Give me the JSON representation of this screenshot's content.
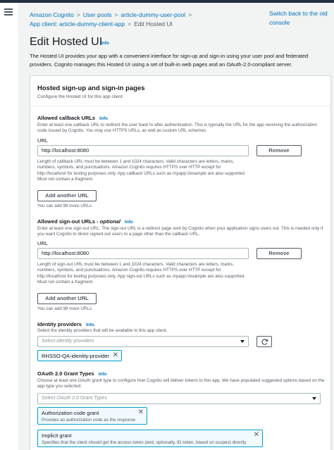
{
  "breadcrumb": {
    "items": [
      "Amazon Cognito",
      "User pools",
      "article-dummy-user-pool",
      "App client: article-dummy-client-app"
    ],
    "current": "Edit Hosted UI"
  },
  "header": {
    "switch_link": "Switch back to the old console",
    "title": "Edit Hosted UI",
    "info": "Info",
    "description": "The Hosted UI provides your app with a convenient interface for sign-up and sign-in using your user pool and federated providers. Cognito manages this Hosted UI using a set of built-in web pages and an OAuth-2.0-compliant server."
  },
  "panel": {
    "title": "Hosted sign-up and sign-in pages",
    "subtitle": "Configure the Hosted UI for this app client."
  },
  "callback": {
    "label": "Allowed callback URLs",
    "info": "Info",
    "help": "Enter at least one callback URL to redirect the user back to after authentication. This is typically the URL for the app receiving the authorization code issued by Cognito. You may use HTTPS URLs, as well as custom URL schemes.",
    "url_label": "URL",
    "url_value": "http://localhost:8080",
    "remove_label": "Remove",
    "constraint": "Length of callback URL must be between 1 and 1024 characters. Valid characters are letters, marks, numbers, symbols, and punctuations. Amazon Cognito requires HTTPS over HTTP except for http://localhost for testing purposes only. App callback URLs such as myapp://example are also supported. Must not contain a fragment.",
    "add_label": "Add another URL",
    "remaining": "You can add 99 more URLs"
  },
  "signout": {
    "label": "Allowed sign-out URLs -",
    "label_optional": "optional",
    "info": "Info",
    "help": "Enter at least one sign-out URL. The sign-out URL is a redirect page sent by Cognito when your application signs users out. This is needed only if you want Cognito to direct signed-out users to a page other than the callback URL.",
    "url_label": "URL",
    "url_value": "http://localhost:8080",
    "remove_label": "Remove",
    "constraint": "Length of sign-out URL must be between 1 and 1024 characters. Valid characters are letters, marks, numbers, symbols, and punctuations. Amazon Cognito requires HTTPS over HTTP except for http://localhost for testing purposes only. App sign-out URLs such as myapp://example are also supported. Must not contain a fragment.",
    "add_label": "Add another URL",
    "remaining": "You can add 99 more URLs"
  },
  "identity": {
    "label": "Identity providers",
    "info": "Info",
    "help": "Select the identity providers that will be available to this app client.",
    "placeholder": "Select identity providers",
    "selected_token": "RHSSO-QA-identity-provider"
  },
  "oauth": {
    "label": "OAuth 2.0 Grant Types",
    "info": "Info",
    "help": "Choose at least one OAuth grant type to configure how Cognito will deliver tokens to this app. We have populated suggested options based on the app type you selected.",
    "placeholder": "Select OAuth 2.0 Grant Types",
    "tokens": [
      {
        "label": "Authorization code grant",
        "desc": "Provides an authorization code as the response"
      },
      {
        "label": "Implicit grant",
        "desc": "Specifies that the client should get the access token (and, optionally, ID token, based on scopes) directly"
      }
    ]
  },
  "icons": {
    "menu": "hamburger-menu-icon",
    "refresh": "refresh-icon",
    "remove_token": "close-icon",
    "dropdown": "caret-down-icon"
  },
  "colors": {
    "link": "#0073bb",
    "token_border": "#00a1c9",
    "token_bg": "#f1faff",
    "topbar": "#232f3e"
  }
}
